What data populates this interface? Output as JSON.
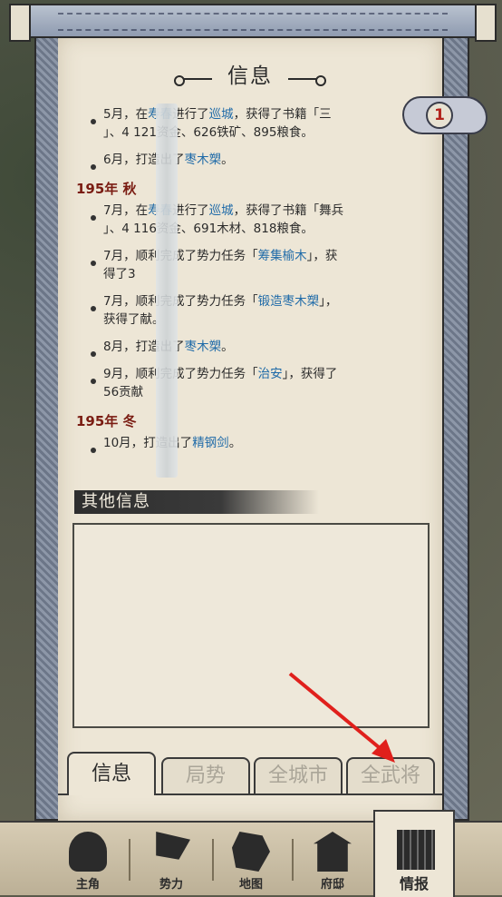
{
  "title": "信息",
  "badge_count": "1",
  "log": {
    "seasons": [
      {
        "label": "",
        "entries": [
          {
            "pre": "5月，",
            "seg1": "",
            "seg2": "在",
            "hl": "寿春",
            "post": "进行了",
            "hl2": "巡城",
            "tail": "，获得了书籍「三",
            "line2": "」、4",
            "line2b": " 121资金、626铁矿、895粮食。"
          },
          {
            "pre": "6月，",
            "seg1": "",
            "seg2": "打造出了",
            "hl": "枣木槊",
            "post": "。",
            "hl2": "",
            "tail": "",
            "line2": "",
            "line2b": ""
          }
        ]
      },
      {
        "label": "195年 秋",
        "entries": [
          {
            "pre": "7月，",
            "seg1": "",
            "seg2": "在",
            "hl": "寿春",
            "post": "进行了",
            "hl2": "巡城",
            "tail": "，获得了书籍「舞兵",
            "line2": "」、4",
            "line2b": " 116资金、691木材、818粮食。"
          },
          {
            "pre": "7月，",
            "seg1": "",
            "seg2": "顺利完成了势力任务「",
            "hl": "筹集榆木",
            "post": "」，获",
            "hl2": "",
            "tail": "",
            "line2": "得了3",
            "line2b": ""
          },
          {
            "pre": "7月，",
            "seg1": "",
            "seg2": "顺利完成了势力任务「",
            "hl": "锻造枣木槊",
            "post": "」，",
            "hl2": "",
            "tail": "",
            "line2": "获得了",
            "line2b": "献。"
          },
          {
            "pre": "8月，",
            "seg1": "",
            "seg2": "打造出了",
            "hl": "枣木槊",
            "post": "。",
            "hl2": "",
            "tail": "",
            "line2": "",
            "line2b": ""
          },
          {
            "pre": "9月，",
            "seg1": "",
            "seg2": "顺利完成了势力任务「",
            "hl": "治安",
            "post": "」，获得了",
            "hl2": "",
            "tail": "",
            "line2": "56贡献",
            "line2b": ""
          }
        ]
      },
      {
        "label": "195年 冬",
        "entries": [
          {
            "pre": "10月，",
            "seg1": "",
            "seg2": "打造出了",
            "hl": "精钢剑",
            "post": "。",
            "hl2": "",
            "tail": "",
            "line2": "",
            "line2b": ""
          }
        ]
      }
    ]
  },
  "other_info": {
    "header": "其他信息"
  },
  "tabs": [
    {
      "label": "信息"
    },
    {
      "label": "局势"
    },
    {
      "label": "全城市"
    },
    {
      "label": "全武将"
    }
  ],
  "nav": [
    {
      "label": "主角"
    },
    {
      "label": "势力"
    },
    {
      "label": "地图"
    },
    {
      "label": "府邸"
    },
    {
      "label": "情报"
    }
  ]
}
